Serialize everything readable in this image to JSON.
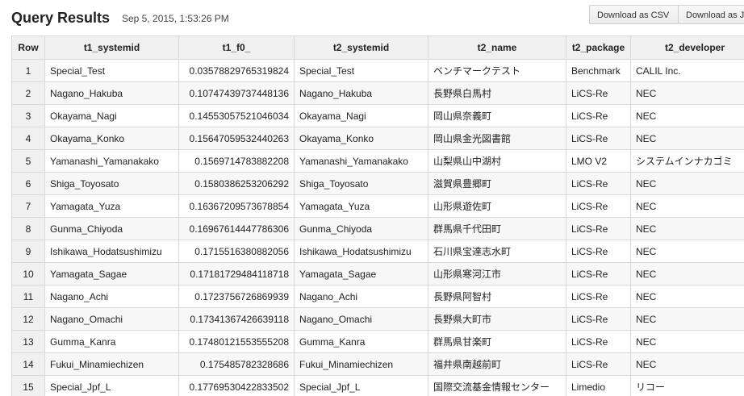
{
  "header": {
    "title": "Query Results",
    "timestamp": "Sep 5, 2015, 1:53:26 PM",
    "download_csv": "Download as CSV",
    "download_json": "Download as JSON"
  },
  "table": {
    "columns": [
      "Row",
      "t1_systemid",
      "t1_f0_",
      "t2_systemid",
      "t2_name",
      "t2_package",
      "t2_developer"
    ],
    "rows": [
      [
        "1",
        "Special_Test",
        "0.03578829765319824",
        "Special_Test",
        "ベンチマークテスト",
        "Benchmark",
        "CALIL Inc."
      ],
      [
        "2",
        "Nagano_Hakuba",
        "0.10747439737448136",
        "Nagano_Hakuba",
        "長野県白馬村",
        "LiCS-Re",
        "NEC"
      ],
      [
        "3",
        "Okayama_Nagi",
        "0.14553057521046034",
        "Okayama_Nagi",
        "岡山県奈義町",
        "LiCS-Re",
        "NEC"
      ],
      [
        "4",
        "Okayama_Konko",
        "0.15647059532440263",
        "Okayama_Konko",
        "岡山県金光図書館",
        "LiCS-Re",
        "NEC"
      ],
      [
        "5",
        "Yamanashi_Yamanakako",
        "0.1569714783882208",
        "Yamanashi_Yamanakako",
        "山梨県山中湖村",
        "LMO V2",
        "システムインナカゴミ"
      ],
      [
        "6",
        "Shiga_Toyosato",
        "0.1580386253206292",
        "Shiga_Toyosato",
        "滋賀県豊郷町",
        "LiCS-Re",
        "NEC"
      ],
      [
        "7",
        "Yamagata_Yuza",
        "0.16367209573678854",
        "Yamagata_Yuza",
        "山形県遊佐町",
        "LiCS-Re",
        "NEC"
      ],
      [
        "8",
        "Gunma_Chiyoda",
        "0.16967614447786306",
        "Gunma_Chiyoda",
        "群馬県千代田町",
        "LiCS-Re",
        "NEC"
      ],
      [
        "9",
        "Ishikawa_Hodatsushimizu",
        "0.1715516380882056",
        "Ishikawa_Hodatsushimizu",
        "石川県宝達志水町",
        "LiCS-Re",
        "NEC"
      ],
      [
        "10",
        "Yamagata_Sagae",
        "0.17181729484118718",
        "Yamagata_Sagae",
        "山形県寒河江市",
        "LiCS-Re",
        "NEC"
      ],
      [
        "11",
        "Nagano_Achi",
        "0.1723756726869939",
        "Nagano_Achi",
        "長野県阿智村",
        "LiCS-Re",
        "NEC"
      ],
      [
        "12",
        "Nagano_Omachi",
        "0.17341367426639118",
        "Nagano_Omachi",
        "長野県大町市",
        "LiCS-Re",
        "NEC"
      ],
      [
        "13",
        "Gumma_Kanra",
        "0.17480121553555208",
        "Gumma_Kanra",
        "群馬県甘楽町",
        "LiCS-Re",
        "NEC"
      ],
      [
        "14",
        "Fukui_Minamiechizen",
        "0.175485782328686",
        "Fukui_Minamiechizen",
        "福井県南越前町",
        "LiCS-Re",
        "NEC"
      ],
      [
        "15",
        "Special_Jpf_L",
        "0.17769530422833502",
        "Special_Jpf_L",
        "国際交流基金情報センター",
        "Limedio",
        "リコー"
      ]
    ]
  }
}
